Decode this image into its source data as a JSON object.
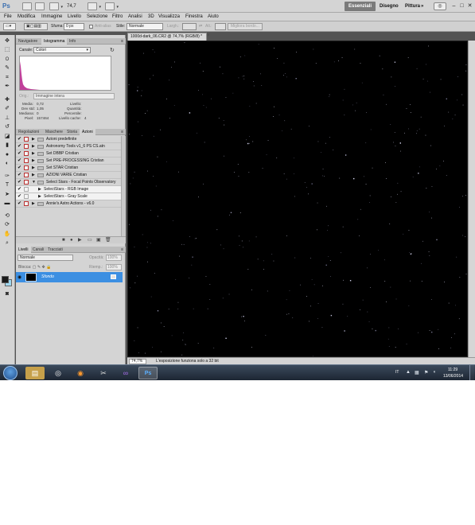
{
  "app": {
    "logo": "Ps",
    "zoom": "74,7",
    "workspaces": [
      "Essenziali",
      "Disegno",
      "Pittura"
    ],
    "more": "»",
    "win_controls": [
      "–",
      "□",
      "✕"
    ]
  },
  "menu": [
    "File",
    "Modifica",
    "Immagine",
    "Livello",
    "Selezione",
    "Filtro",
    "Analisi",
    "3D",
    "Visualizza",
    "Finestra",
    "Aiuto"
  ],
  "options": {
    "feather_label": "Sfuma:",
    "feather_value": "0 px",
    "antialias_label": "Anti-alias",
    "style_label": "Stile:",
    "style_value": "Normale",
    "width_label": "Largh.:",
    "height_label": "Alt.:",
    "refine_edge": "Migliora bordo..."
  },
  "histogram_panel": {
    "tabs": [
      "Navigatore",
      "Istogramma",
      "Info"
    ],
    "channel_label": "Canale:",
    "channel_value": "Colori",
    "source_label": "Orig.:",
    "source_value": "Immagine intera",
    "stats": {
      "media_label": "Media:",
      "media_value": "0,72",
      "devstd_label": "Dev std:",
      "devstd_value": "1,05",
      "mediana_label": "Mediana:",
      "mediana_value": "0",
      "pixel_label": "Pixel:",
      "pixel_value": "157464",
      "livello_label": "Livello:",
      "quantita_label": "Quantità:",
      "percentile_label": "Percentile:",
      "cache_label": "Livello cache:",
      "cache_value": "4"
    },
    "colors": {
      "histogram": "#c0409a"
    }
  },
  "actions_panel": {
    "tabs": [
      "Regolazioni",
      "Maschere",
      "Storia",
      "Azioni"
    ],
    "items": [
      {
        "label": "Azioni predefinite"
      },
      {
        "label": "Astronomy Tools v1_6 PS CS.atn"
      },
      {
        "label": "Set DBBP Cristian"
      },
      {
        "label": "Set PRE-PROCESSING Cristian"
      },
      {
        "label": "Set STAR Cristian"
      },
      {
        "label": "AZIONI VARIE Cristian"
      },
      {
        "label": "Select Stars - Focal Points Observatory"
      },
      {
        "label": "SelectStars - RGB Image"
      },
      {
        "label": "SelectStars - Gray Scale"
      },
      {
        "label": "Annie's Astro Actions - v6.0"
      }
    ]
  },
  "layers_panel": {
    "tabs": [
      "Livelli",
      "Canali",
      "Tracciati"
    ],
    "blend_mode": "Normale",
    "opacity_label": "Opacità:",
    "opacity_value": "100%",
    "lock_label": "Blocca:",
    "fill_label": "Riemp.:",
    "fill_value": "100%",
    "layer_name": "Sfondo"
  },
  "document": {
    "tab_title": "1000d-dark_06.CR2 @ 74,7% (RGB/8) *",
    "status_zoom": "74,7%",
    "status_text": "L'esposizione funziona solo a 32 bit"
  },
  "taskbar": {
    "language": "IT",
    "time": "11:29",
    "date": "13/06/2014"
  }
}
